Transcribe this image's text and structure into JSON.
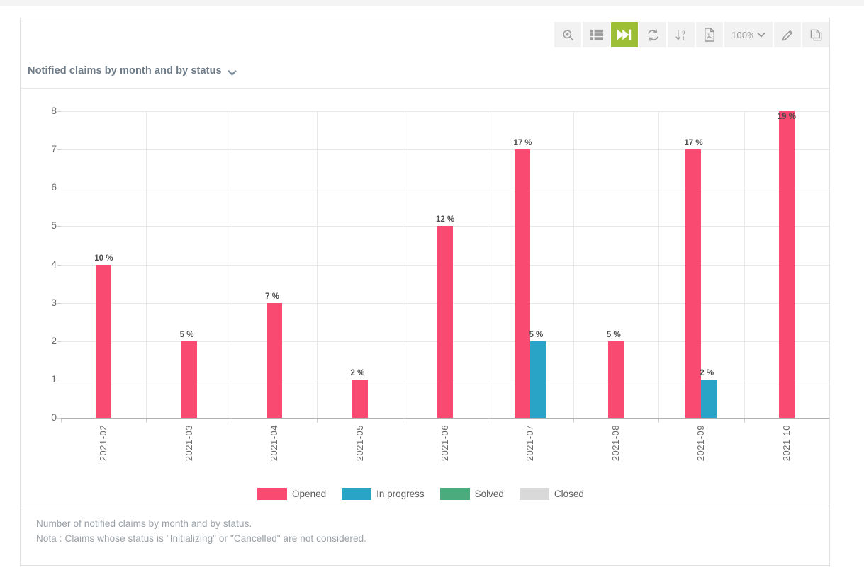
{
  "toolbar": {
    "buttons": [
      {
        "name": "zoom-search-icon",
        "label": "Zoom"
      },
      {
        "name": "list-view-icon",
        "label": "List view"
      },
      {
        "name": "skip-forward-icon",
        "label": "Skip to end",
        "active": true
      },
      {
        "name": "refresh-icon",
        "label": "Refresh"
      },
      {
        "name": "sort-descending-icon",
        "label": "Sort"
      },
      {
        "name": "pdf-export-icon",
        "label": "Export PDF"
      }
    ],
    "zoom_value": "100%",
    "edit_label": "Edit",
    "copy_label": "Copy"
  },
  "header": {
    "title": "Notified claims by month and by status"
  },
  "footer": {
    "line1": "Number of notified claims by month and by status.",
    "line2": "Nota : Claims whose status is \"Initializing\" or \"Cancelled\" are not considered."
  },
  "colors": {
    "opened": "#f94a72",
    "in_progress": "#29a3c6",
    "solved": "#4cab7d",
    "closed": "#d9d9d9",
    "active_button": "#9dbf36",
    "title_text": "#6e7b87",
    "grid": "#e8e8e8"
  },
  "chart_data": {
    "type": "bar",
    "title": "Notified claims by month and by status",
    "xlabel": "",
    "ylabel": "",
    "ylim": [
      0,
      8
    ],
    "yticks": [
      0,
      1,
      2,
      3,
      4,
      5,
      6,
      7,
      8
    ],
    "grid": true,
    "legend_position": "bottom",
    "categories": [
      "2021-02",
      "2021-03",
      "2021-04",
      "2021-05",
      "2021-06",
      "2021-07",
      "2021-08",
      "2021-09",
      "2021-10"
    ],
    "series": [
      {
        "name": "Opened",
        "color": "#f94a72",
        "values": [
          4,
          2,
          3,
          1,
          5,
          7,
          2,
          7,
          8
        ],
        "labels": [
          "10 %",
          "5 %",
          "7 %",
          "2 %",
          "12 %",
          "17 %",
          "5 %",
          "17 %",
          "19 %"
        ]
      },
      {
        "name": "In progress",
        "color": "#29a3c6",
        "values": [
          0,
          0,
          0,
          0,
          0,
          2,
          0,
          1,
          0
        ],
        "labels": [
          "",
          "",
          "",
          "",
          "",
          "5 %",
          "",
          "2 %",
          ""
        ]
      },
      {
        "name": "Solved",
        "color": "#4cab7d",
        "values": [
          0,
          0,
          0,
          0,
          0,
          0,
          0,
          0,
          0
        ],
        "labels": [
          "",
          "",
          "",
          "",
          "",
          "",
          "",
          "",
          ""
        ]
      },
      {
        "name": "Closed",
        "color": "#d9d9d9",
        "values": [
          0,
          0,
          0,
          0,
          0,
          0,
          0,
          0,
          0
        ],
        "labels": [
          "",
          "",
          "",
          "",
          "",
          "",
          "",
          "",
          ""
        ]
      }
    ]
  }
}
